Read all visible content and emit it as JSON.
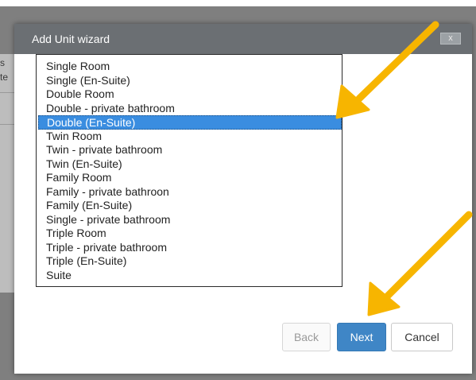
{
  "background_page": {
    "letters": [
      "s",
      "te"
    ]
  },
  "dialog": {
    "title": "Add Unit wizard",
    "close_label": "x"
  },
  "unit_types": {
    "items": [
      "Single Room",
      "Single (En-Suite)",
      "Double Room",
      "Double - private bathroom",
      "Double (En-Suite)",
      "Twin Room",
      "Twin - private bathroom",
      "Twin (En-Suite)",
      "Family Room",
      "Family - private bathroon",
      "Family (En-Suite)",
      "Single - private bathroom",
      "Triple Room",
      "Triple - private bathroom",
      "Triple (En-Suite)",
      "Suite"
    ],
    "selected": "Double (En-Suite)"
  },
  "footer": {
    "back_label": "Back",
    "next_label": "Next",
    "cancel_label": "Cancel"
  },
  "colors": {
    "header": "#6b6f73",
    "selection": "#3a8de0",
    "primary_button": "#3f86c6",
    "annotation_arrow": "#f7b500"
  }
}
